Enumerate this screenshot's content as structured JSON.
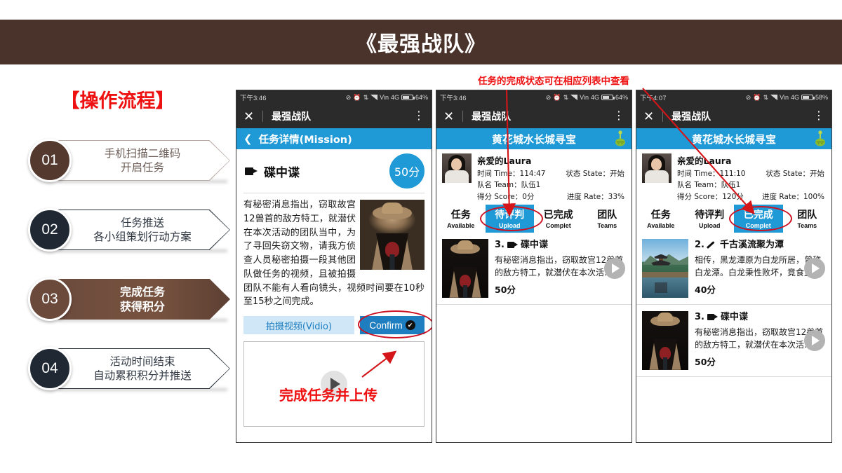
{
  "banner": {
    "title": "《最强战队》"
  },
  "flow": {
    "heading": "【操作流程】",
    "steps": [
      {
        "number": "01",
        "line1": "手机扫描二维码",
        "line2": "开启任务",
        "style": "outline-light"
      },
      {
        "number": "02",
        "line1": "任务推送",
        "line2": "各小组策划行动方案",
        "style": "outline-dark"
      },
      {
        "number": "03",
        "line1": "完成任务",
        "line2": "获得积分",
        "style": "filled-brown"
      },
      {
        "number": "04",
        "line1": "活动时间结束",
        "line2": "自动累积积分并推送",
        "style": "outline-dark"
      }
    ]
  },
  "annotations": {
    "top": "任务的完成状态可在相应列表中查看",
    "bottom": "完成任务并上传",
    "color": "#ee1111"
  },
  "colors": {
    "banner_brown": "#4a332b",
    "accent_blue": "#1f9ad6",
    "button_blue": "#1f7ec0",
    "light_blue": "#cfe7f7",
    "annotation_red": "#ee1111"
  },
  "phone1": {
    "status": {
      "time": "下午3:46",
      "carrier": "Vin",
      "network": "4G",
      "battery": "64%"
    },
    "appbar": {
      "close": "✕",
      "title": "最强战队",
      "more": "⋮"
    },
    "bluebar": {
      "back": "❮",
      "title": "任务详情(Mission)"
    },
    "mission": {
      "icon": "video-camera-icon",
      "title": "碟中谍",
      "score": "50分",
      "body": "有秘密消息指出，窃取故宫12兽首的敌方特工，就潜伏在本次活动的团队当中，为了寻回失窃文物，请我方侦查人员秘密拍摄一段其他团队做任务的视频，且被拍摄团队不能有人看向镜头，视频时间要在10秒至15秒之间完成。"
    },
    "buttons": {
      "video": "拍摄视频(Vidio)",
      "confirm": "Confirm"
    }
  },
  "phone2": {
    "status": {
      "time": "下午3:46",
      "carrier": "Vin",
      "network": "4G",
      "battery": "64%"
    },
    "appbar": {
      "close": "✕",
      "title": "最强战队",
      "more": "⋮"
    },
    "bluebar": {
      "title": "黄花城水长城寻宝"
    },
    "user": {
      "name": "亲爱的Laura",
      "time_label": "时间 Time：",
      "time_value": "114:47",
      "state_label": "状态 State：",
      "state_value": "开始",
      "team_label": "队名 Team：",
      "team_value": "队伍1",
      "score_label": "得分 Score：",
      "score_value": "0分",
      "rate_label": "进度 Rate：",
      "rate_value": "33%"
    },
    "tabs": [
      {
        "cn": "任务",
        "en": "Available",
        "active": false
      },
      {
        "cn": "待评判",
        "en": "Upload",
        "active": true
      },
      {
        "cn": "已完成",
        "en": "Complet",
        "active": false
      },
      {
        "cn": "团队",
        "en": "Teams",
        "active": false
      }
    ],
    "items": [
      {
        "index": "3.",
        "icon": "video-camera-icon",
        "title": "碟中谍",
        "desc": "有秘密消息指出，窃取故宫12兽首的敌方特工，就潜伏在本次活…",
        "score": "50分",
        "thumb": "spy"
      }
    ]
  },
  "phone3": {
    "status": {
      "time": "下午4:07",
      "carrier": "Vin",
      "network": "4G",
      "battery": "58%"
    },
    "appbar": {
      "close": "✕",
      "title": "最强战队",
      "more": "⋮"
    },
    "bluebar": {
      "title": "黄花城水长城寻宝"
    },
    "user": {
      "name": "亲爱的Laura",
      "time_label": "时间 Time：",
      "time_value": "111:10",
      "state_label": "状态 State：",
      "state_value": "开始",
      "team_label": "队名 Team：",
      "team_value": "队伍1",
      "score_label": "得分 Score：",
      "score_value": "120分",
      "rate_label": "进度 Rate：",
      "rate_value": "100%"
    },
    "tabs": [
      {
        "cn": "任务",
        "en": "Available",
        "active": false
      },
      {
        "cn": "待评判",
        "en": "Upload",
        "active": false
      },
      {
        "cn": "已完成",
        "en": "Complet",
        "active": true
      },
      {
        "cn": "团队",
        "en": "Teams",
        "active": false
      }
    ],
    "items": [
      {
        "index": "2.",
        "icon": "pen-icon",
        "title": "千古溪流聚为潭",
        "desc": "相传，黑龙潭原为白龙所居，曾称白龙潭。白龙秉性败坏，竟食童…",
        "score": "40分",
        "thumb": "lake"
      },
      {
        "index": "3.",
        "icon": "video-camera-icon",
        "title": "碟中谍",
        "desc": "有秘密消息指出，窃取故宫12兽首的敌方特工，就潜伏在本次活…",
        "score": "50分",
        "thumb": "spy"
      }
    ]
  }
}
